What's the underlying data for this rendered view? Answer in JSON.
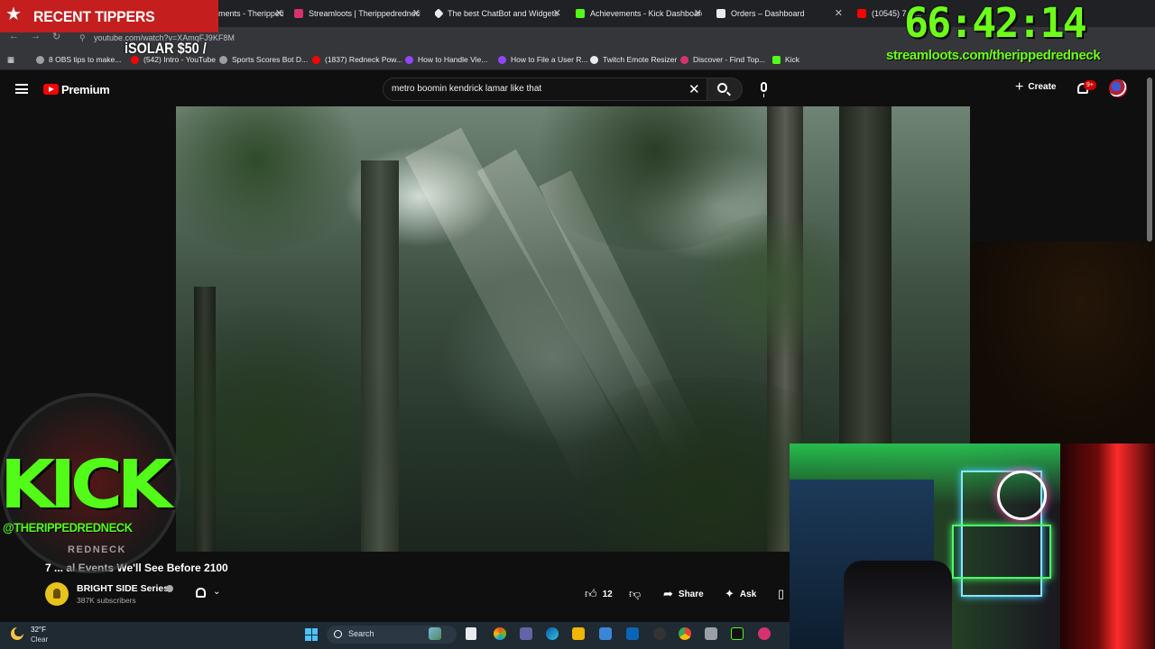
{
  "browser": {
    "tabs": [
      {
        "title": "StreamElements - Therippedredneck",
        "color": "#5a4fcf"
      },
      {
        "title": "Streamloots | Therippedredneck",
        "color": "#d6336c"
      },
      {
        "title": "The best ChatBot and Widgets",
        "color": "#e8eaed"
      },
      {
        "title": "Achievements - Kick Dashboard",
        "color": "#53fc18"
      },
      {
        "title": "Orders – Dashboard",
        "color": "#e8eaed"
      },
      {
        "title": "(10545) 7 R...",
        "color": "#ff0000"
      }
    ],
    "url": "youtube.com/watch?v=XAmqFJ9KF8M",
    "bookmarks": [
      {
        "label": "8 OBS tips to make...",
        "color": "#9aa0a6"
      },
      {
        "label": "(542) Intro - YouTube",
        "color": "#ff0000"
      },
      {
        "label": "Sports Scores Bot D...",
        "color": "#9aa0a6"
      },
      {
        "label": "(1837) Redneck Pow...",
        "color": "#ff0000"
      },
      {
        "label": "How to Handle Vie...",
        "color": "#9146ff"
      },
      {
        "label": "How to File a User R...",
        "color": "#9146ff"
      },
      {
        "label": "Twitch Emote Resizer",
        "color": "#e8eaed"
      },
      {
        "label": "Discover - Find Top...",
        "color": "#d6336c"
      },
      {
        "label": "Kick",
        "color": "#53fc18"
      }
    ]
  },
  "youtube": {
    "brand": "Premium",
    "search_query": "metro boomin kendrick lamar like that",
    "create_label": "Create",
    "notifications_badge": "9+",
    "video_title": "7 ... al Events We'll See Before 2100",
    "channel_name": "BRIGHT SIDE Series",
    "subscribers": "387K subscribers",
    "like_count": "12",
    "share_label": "Share",
    "ask_label": "Ask"
  },
  "taskbar": {
    "temperature": "32°F",
    "condition": "Clear",
    "search_placeholder": "Search"
  },
  "overlays": {
    "recent_tippers_label": "RECENT TIPPERS",
    "tipper_line": "iSOLAR $50 /",
    "timer": "66:42:14",
    "stream_url": "streamloots.com/therippedredneck",
    "kick_label": "KICK",
    "kick_handle": "@THERIPPEDREDNECK",
    "kick_sub": "REDNECK"
  },
  "colors": {
    "youtube_red": "#ff0000",
    "kick_green": "#53fc18",
    "timer_green": "#6dff1a",
    "tippers_red": "#c41e1e"
  }
}
